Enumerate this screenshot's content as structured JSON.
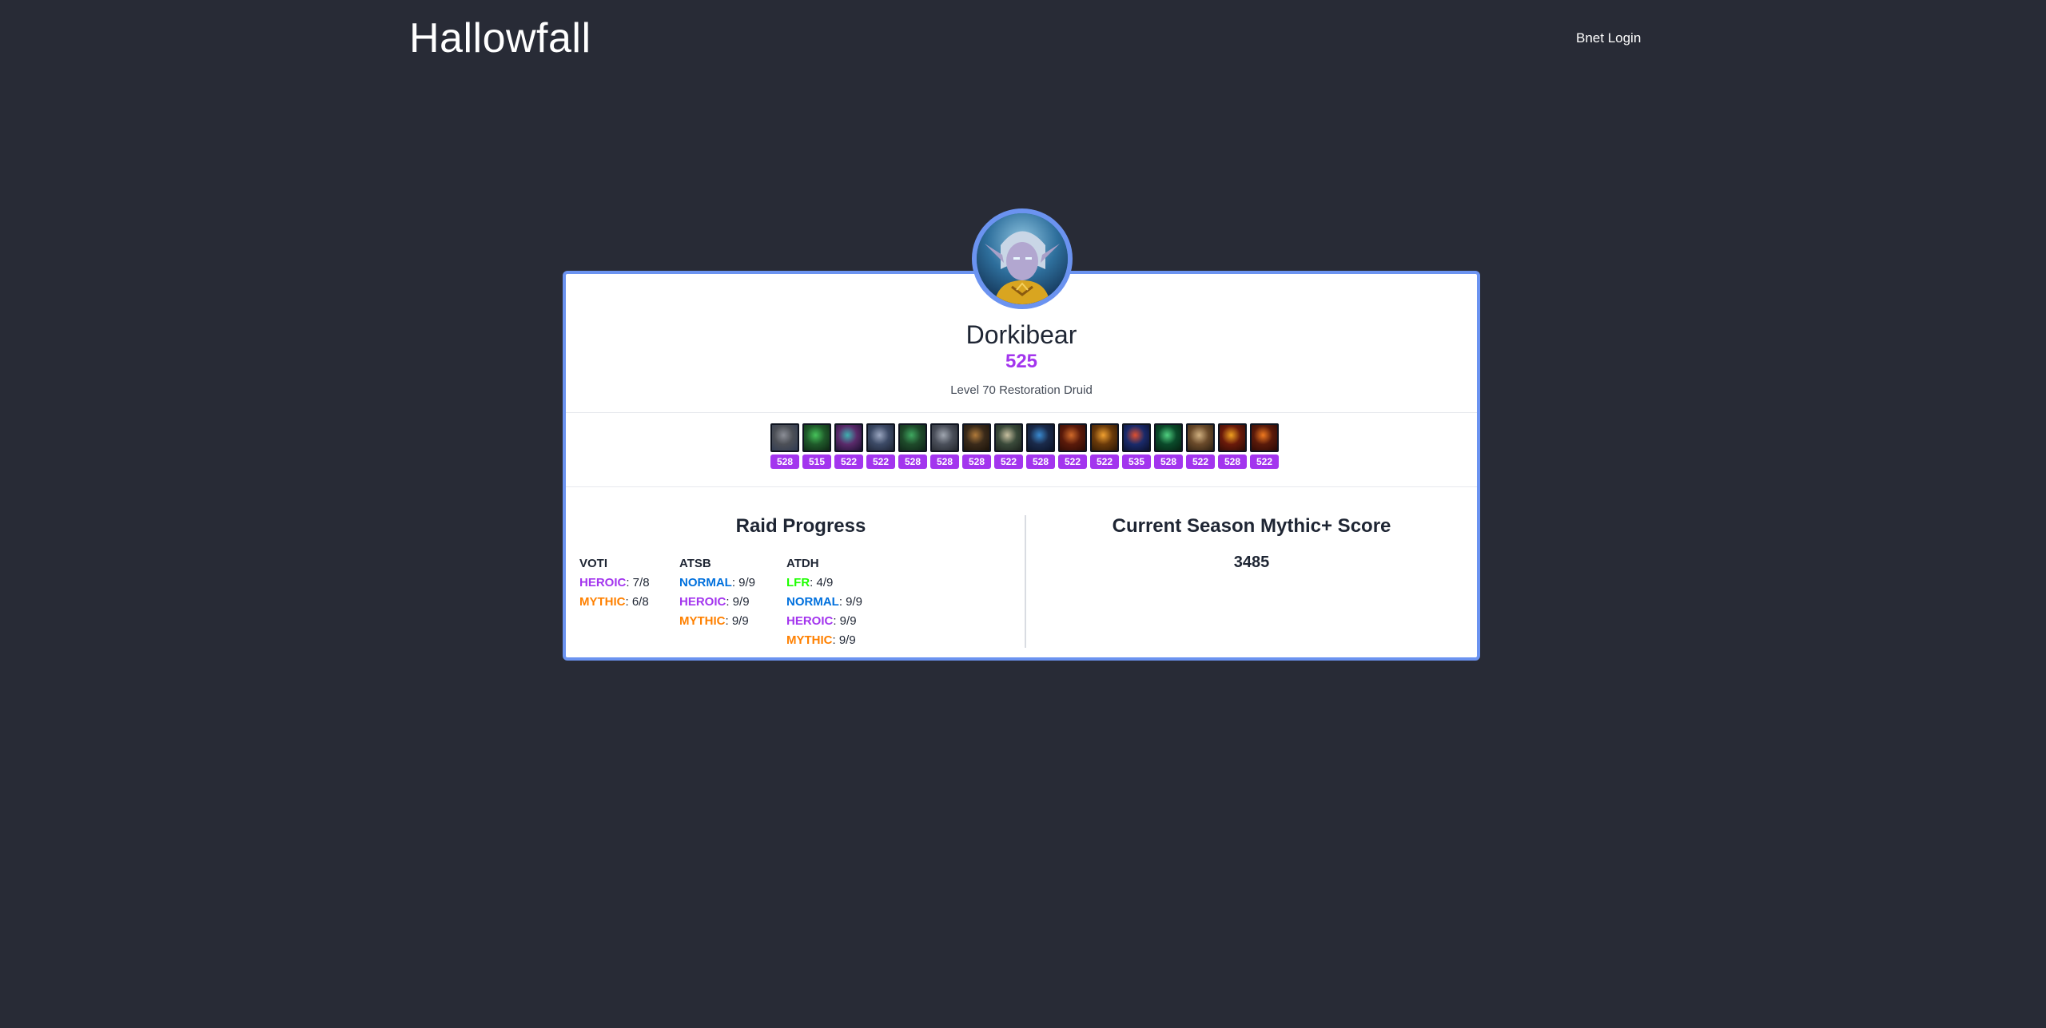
{
  "header": {
    "site_title": "Hallowfall",
    "login_label": "Bnet Login"
  },
  "character": {
    "name": "Dorkibear",
    "item_level": "525",
    "description": "Level 70 Restoration Druid"
  },
  "gear": [
    {
      "icon": "shoulder-gear-icon",
      "ilvl": "528",
      "c1": "#4c4f56",
      "c2": "#8b8e96",
      "c3": "#2f3a52"
    },
    {
      "icon": "neck-gear-icon",
      "ilvl": "515",
      "c1": "#1f5a2a",
      "c2": "#46c35a",
      "c3": "#0d2412"
    },
    {
      "icon": "head-gear-icon",
      "ilvl": "522",
      "c1": "#5a2a6a",
      "c2": "#3fb0b0",
      "c3": "#1b1030"
    },
    {
      "icon": "chest-gear-icon",
      "ilvl": "522",
      "c1": "#3c4a66",
      "c2": "#9aa6c0",
      "c3": "#1c2233"
    },
    {
      "icon": "cloak-gear-icon",
      "ilvl": "528",
      "c1": "#1e4a2a",
      "c2": "#3fa860",
      "c3": "#0e2216"
    },
    {
      "icon": "bracer-gear-icon",
      "ilvl": "528",
      "c1": "#4a4f5a",
      "c2": "#a0a6b0",
      "c3": "#23262c"
    },
    {
      "icon": "gloves-gear-icon",
      "ilvl": "528",
      "c1": "#3a2a1a",
      "c2": "#b07a3a",
      "c3": "#1a1208"
    },
    {
      "icon": "belt-gear-icon",
      "ilvl": "522",
      "c1": "#3a4a3a",
      "c2": "#c8c0a0",
      "c3": "#1a201a"
    },
    {
      "icon": "legs-gear-icon",
      "ilvl": "528",
      "c1": "#1a2a4a",
      "c2": "#3a8ad0",
      "c3": "#0a1226"
    },
    {
      "icon": "boots-gear-icon",
      "ilvl": "522",
      "c1": "#5a1a0a",
      "c2": "#d06a2a",
      "c3": "#2a0a04"
    },
    {
      "icon": "ring-gear-icon",
      "ilvl": "522",
      "c1": "#6a3a0a",
      "c2": "#f0a030",
      "c3": "#2a1604"
    },
    {
      "icon": "ring-2-gear-icon",
      "ilvl": "535",
      "c1": "#1a2a6a",
      "c2": "#e05030",
      "c3": "#0a0f2a"
    },
    {
      "icon": "trinket-gear-icon",
      "ilvl": "528",
      "c1": "#0a4a2a",
      "c2": "#50d080",
      "c3": "#062010"
    },
    {
      "icon": "trinket-2-gear-icon",
      "ilvl": "522",
      "c1": "#6a4a2a",
      "c2": "#d0b080",
      "c3": "#2a1e10"
    },
    {
      "icon": "weapon-gear-icon",
      "ilvl": "528",
      "c1": "#6a1a0a",
      "c2": "#f0a020",
      "c3": "#2a0a04"
    },
    {
      "icon": "offhand-gear-icon",
      "ilvl": "522",
      "c1": "#5a1a0a",
      "c2": "#f07a20",
      "c3": "#2a0804"
    }
  ],
  "raid_progress": {
    "title": "Raid Progress",
    "raids": [
      {
        "name": "VOTI",
        "rows": [
          {
            "difficulty": "HEROIC",
            "color": "#a335ee",
            "progress": ": 7/8"
          },
          {
            "difficulty": "MYTHIC",
            "color": "#ff8000",
            "progress": ": 6/8"
          }
        ]
      },
      {
        "name": "ATSB",
        "rows": [
          {
            "difficulty": "NORMAL",
            "color": "#0070dd",
            "progress": ": 9/9"
          },
          {
            "difficulty": "HEROIC",
            "color": "#a335ee",
            "progress": ": 9/9"
          },
          {
            "difficulty": "MYTHIC",
            "color": "#ff8000",
            "progress": ": 9/9"
          }
        ]
      },
      {
        "name": "ATDH",
        "rows": [
          {
            "difficulty": "LFR",
            "color": "#1eff00",
            "progress": ": 4/9"
          },
          {
            "difficulty": "NORMAL",
            "color": "#0070dd",
            "progress": ": 9/9"
          },
          {
            "difficulty": "HEROIC",
            "color": "#a335ee",
            "progress": ": 9/9"
          },
          {
            "difficulty": "MYTHIC",
            "color": "#ff8000",
            "progress": ": 9/9"
          }
        ]
      }
    ]
  },
  "mythic_plus": {
    "title": "Current Season Mythic+ Score",
    "score": "3485"
  },
  "colors": {
    "background": "#282b36",
    "accent_border": "#6b93f0",
    "epic": "#a335ee"
  }
}
